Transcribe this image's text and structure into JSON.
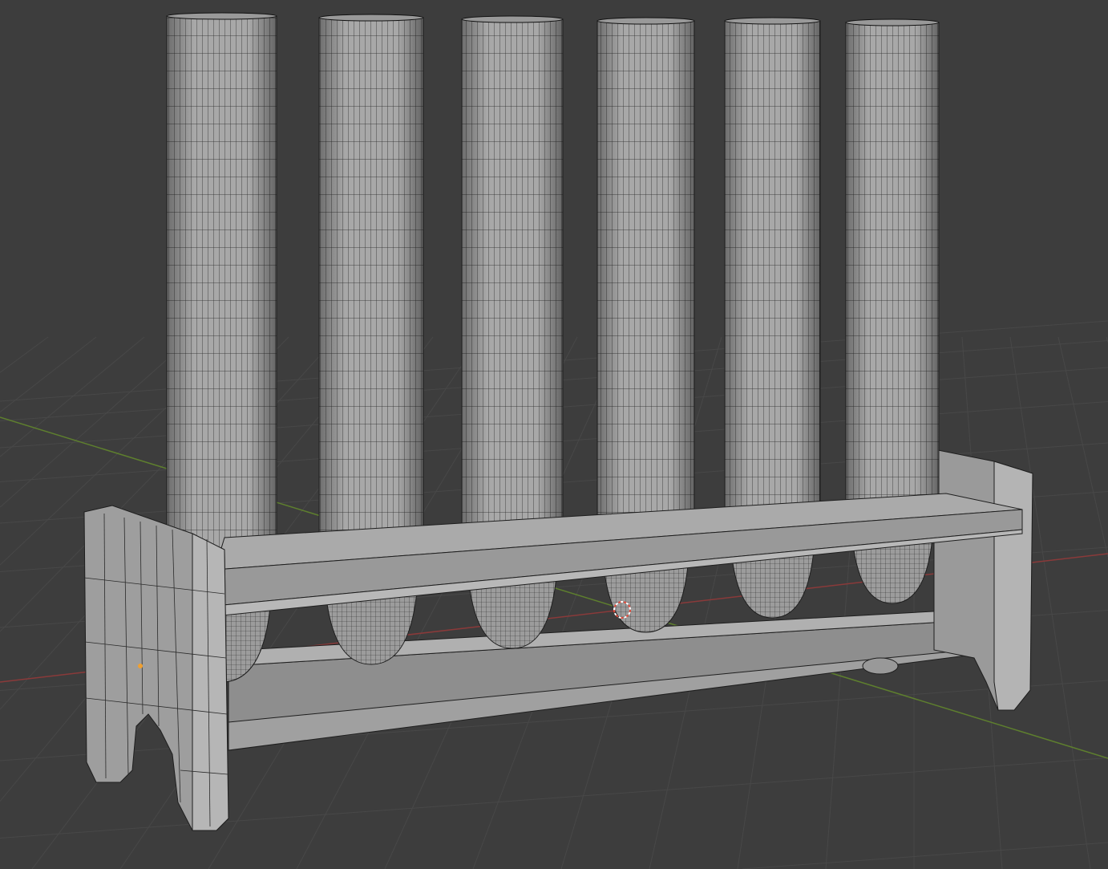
{
  "viewport": {
    "background": "#3d3d3d",
    "grid_color": "#484848",
    "x_axis_color": "#8a3a3a",
    "y_axis_color": "#5e7f2e",
    "mesh_fill": "#a6a6a6",
    "mesh_fill_dark": "#8c8c8c",
    "wire_color": "#1e1e1e",
    "cursor_color": "#d9534f",
    "origin_color": "#f0a030"
  }
}
